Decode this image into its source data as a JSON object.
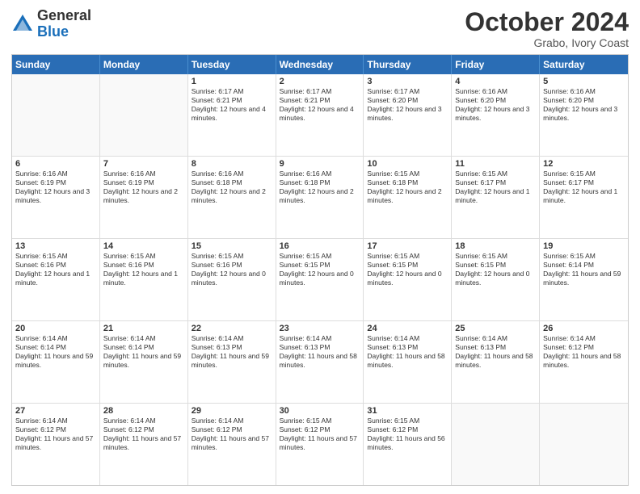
{
  "header": {
    "logo_general": "General",
    "logo_blue": "Blue",
    "month": "October 2024",
    "location": "Grabo, Ivory Coast"
  },
  "days_of_week": [
    "Sunday",
    "Monday",
    "Tuesday",
    "Wednesday",
    "Thursday",
    "Friday",
    "Saturday"
  ],
  "weeks": [
    [
      {
        "day": "",
        "empty": true
      },
      {
        "day": "",
        "empty": true
      },
      {
        "day": "1",
        "sunrise": "Sunrise: 6:17 AM",
        "sunset": "Sunset: 6:21 PM",
        "daylight": "Daylight: 12 hours and 4 minutes."
      },
      {
        "day": "2",
        "sunrise": "Sunrise: 6:17 AM",
        "sunset": "Sunset: 6:21 PM",
        "daylight": "Daylight: 12 hours and 4 minutes."
      },
      {
        "day": "3",
        "sunrise": "Sunrise: 6:17 AM",
        "sunset": "Sunset: 6:20 PM",
        "daylight": "Daylight: 12 hours and 3 minutes."
      },
      {
        "day": "4",
        "sunrise": "Sunrise: 6:16 AM",
        "sunset": "Sunset: 6:20 PM",
        "daylight": "Daylight: 12 hours and 3 minutes."
      },
      {
        "day": "5",
        "sunrise": "Sunrise: 6:16 AM",
        "sunset": "Sunset: 6:20 PM",
        "daylight": "Daylight: 12 hours and 3 minutes."
      }
    ],
    [
      {
        "day": "6",
        "sunrise": "Sunrise: 6:16 AM",
        "sunset": "Sunset: 6:19 PM",
        "daylight": "Daylight: 12 hours and 3 minutes."
      },
      {
        "day": "7",
        "sunrise": "Sunrise: 6:16 AM",
        "sunset": "Sunset: 6:19 PM",
        "daylight": "Daylight: 12 hours and 2 minutes."
      },
      {
        "day": "8",
        "sunrise": "Sunrise: 6:16 AM",
        "sunset": "Sunset: 6:18 PM",
        "daylight": "Daylight: 12 hours and 2 minutes."
      },
      {
        "day": "9",
        "sunrise": "Sunrise: 6:16 AM",
        "sunset": "Sunset: 6:18 PM",
        "daylight": "Daylight: 12 hours and 2 minutes."
      },
      {
        "day": "10",
        "sunrise": "Sunrise: 6:15 AM",
        "sunset": "Sunset: 6:18 PM",
        "daylight": "Daylight: 12 hours and 2 minutes."
      },
      {
        "day": "11",
        "sunrise": "Sunrise: 6:15 AM",
        "sunset": "Sunset: 6:17 PM",
        "daylight": "Daylight: 12 hours and 1 minute."
      },
      {
        "day": "12",
        "sunrise": "Sunrise: 6:15 AM",
        "sunset": "Sunset: 6:17 PM",
        "daylight": "Daylight: 12 hours and 1 minute."
      }
    ],
    [
      {
        "day": "13",
        "sunrise": "Sunrise: 6:15 AM",
        "sunset": "Sunset: 6:16 PM",
        "daylight": "Daylight: 12 hours and 1 minute."
      },
      {
        "day": "14",
        "sunrise": "Sunrise: 6:15 AM",
        "sunset": "Sunset: 6:16 PM",
        "daylight": "Daylight: 12 hours and 1 minute."
      },
      {
        "day": "15",
        "sunrise": "Sunrise: 6:15 AM",
        "sunset": "Sunset: 6:16 PM",
        "daylight": "Daylight: 12 hours and 0 minutes."
      },
      {
        "day": "16",
        "sunrise": "Sunrise: 6:15 AM",
        "sunset": "Sunset: 6:15 PM",
        "daylight": "Daylight: 12 hours and 0 minutes."
      },
      {
        "day": "17",
        "sunrise": "Sunrise: 6:15 AM",
        "sunset": "Sunset: 6:15 PM",
        "daylight": "Daylight: 12 hours and 0 minutes."
      },
      {
        "day": "18",
        "sunrise": "Sunrise: 6:15 AM",
        "sunset": "Sunset: 6:15 PM",
        "daylight": "Daylight: 12 hours and 0 minutes."
      },
      {
        "day": "19",
        "sunrise": "Sunrise: 6:15 AM",
        "sunset": "Sunset: 6:14 PM",
        "daylight": "Daylight: 11 hours and 59 minutes."
      }
    ],
    [
      {
        "day": "20",
        "sunrise": "Sunrise: 6:14 AM",
        "sunset": "Sunset: 6:14 PM",
        "daylight": "Daylight: 11 hours and 59 minutes."
      },
      {
        "day": "21",
        "sunrise": "Sunrise: 6:14 AM",
        "sunset": "Sunset: 6:14 PM",
        "daylight": "Daylight: 11 hours and 59 minutes."
      },
      {
        "day": "22",
        "sunrise": "Sunrise: 6:14 AM",
        "sunset": "Sunset: 6:13 PM",
        "daylight": "Daylight: 11 hours and 59 minutes."
      },
      {
        "day": "23",
        "sunrise": "Sunrise: 6:14 AM",
        "sunset": "Sunset: 6:13 PM",
        "daylight": "Daylight: 11 hours and 58 minutes."
      },
      {
        "day": "24",
        "sunrise": "Sunrise: 6:14 AM",
        "sunset": "Sunset: 6:13 PM",
        "daylight": "Daylight: 11 hours and 58 minutes."
      },
      {
        "day": "25",
        "sunrise": "Sunrise: 6:14 AM",
        "sunset": "Sunset: 6:13 PM",
        "daylight": "Daylight: 11 hours and 58 minutes."
      },
      {
        "day": "26",
        "sunrise": "Sunrise: 6:14 AM",
        "sunset": "Sunset: 6:12 PM",
        "daylight": "Daylight: 11 hours and 58 minutes."
      }
    ],
    [
      {
        "day": "27",
        "sunrise": "Sunrise: 6:14 AM",
        "sunset": "Sunset: 6:12 PM",
        "daylight": "Daylight: 11 hours and 57 minutes."
      },
      {
        "day": "28",
        "sunrise": "Sunrise: 6:14 AM",
        "sunset": "Sunset: 6:12 PM",
        "daylight": "Daylight: 11 hours and 57 minutes."
      },
      {
        "day": "29",
        "sunrise": "Sunrise: 6:14 AM",
        "sunset": "Sunset: 6:12 PM",
        "daylight": "Daylight: 11 hours and 57 minutes."
      },
      {
        "day": "30",
        "sunrise": "Sunrise: 6:15 AM",
        "sunset": "Sunset: 6:12 PM",
        "daylight": "Daylight: 11 hours and 57 minutes."
      },
      {
        "day": "31",
        "sunrise": "Sunrise: 6:15 AM",
        "sunset": "Sunset: 6:12 PM",
        "daylight": "Daylight: 11 hours and 56 minutes."
      },
      {
        "day": "",
        "empty": true
      },
      {
        "day": "",
        "empty": true
      }
    ]
  ]
}
